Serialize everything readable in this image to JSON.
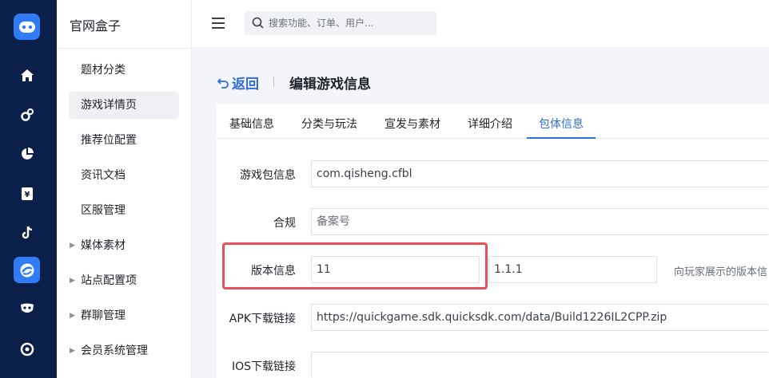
{
  "rail": {
    "icons": [
      "logo-gamepad-icon",
      "home-icon",
      "settings-cog-icon",
      "pie-chart-icon",
      "ticket-yen-icon",
      "tiktok-icon",
      "brand-circle-icon",
      "mask-icon",
      "target-icon"
    ],
    "active_index": 6,
    "accent_color": "#2f7cf6",
    "bg_color": "#0b1f4b"
  },
  "menu": {
    "brand": "官网盒子",
    "items": [
      {
        "label": "题材分类",
        "expandable": false
      },
      {
        "label": "游戏详情页",
        "expandable": false,
        "active": true
      },
      {
        "label": "推荐位配置",
        "expandable": false
      },
      {
        "label": "资讯文档",
        "expandable": false
      },
      {
        "label": "区服管理",
        "expandable": false
      },
      {
        "label": "媒体素材",
        "expandable": true
      },
      {
        "label": "站点配置项",
        "expandable": true
      },
      {
        "label": "群聊管理",
        "expandable": true
      },
      {
        "label": "会员系统管理",
        "expandable": true
      }
    ]
  },
  "topbar": {
    "search_placeholder": "搜索功能、订单、用户..."
  },
  "header": {
    "back_label": "返回",
    "title": "编辑游戏信息"
  },
  "tabs": [
    {
      "label": "基础信息"
    },
    {
      "label": "分类与玩法"
    },
    {
      "label": "宣发与素材"
    },
    {
      "label": "详细介绍"
    },
    {
      "label": "包体信息",
      "active": true
    }
  ],
  "form": {
    "package": {
      "label": "游戏包信息",
      "value": "com.qisheng.cfbl"
    },
    "compliance": {
      "label": "合规",
      "placeholder": "备案号"
    },
    "version": {
      "label": "版本信息",
      "code": "11",
      "name": "1.1.1",
      "hint": "向玩家展示的版本信"
    },
    "apk": {
      "label": "APK下载链接",
      "value": "https://quickgame.sdk.quicksdk.com/data/Build1226IL2CPP.zip"
    },
    "ios": {
      "label": "IOS下载链接",
      "value": ""
    }
  },
  "highlight_color": "#e8505b",
  "link_color": "#2f6ddc"
}
